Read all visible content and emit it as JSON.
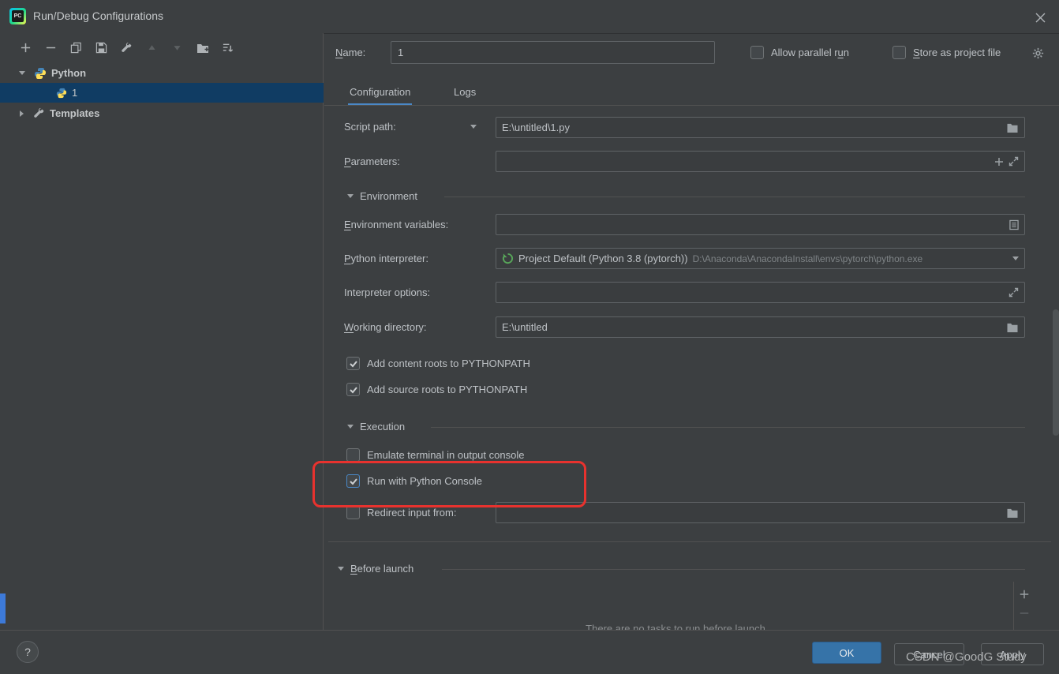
{
  "colors": {
    "dialog_background": "#3c3f41",
    "selection_blue": "#103c63",
    "tab_accent": "#4a88c7",
    "ok_button_blue": "#3673a8",
    "annotation_red": "#e8322e"
  },
  "title_bar": {
    "title": "Run/Debug Configurations"
  },
  "toolbar": {
    "icons": [
      "add",
      "remove",
      "copy",
      "save-configuration",
      "edit-templates",
      "move-up",
      "move-down",
      "create-new-folder",
      "sort-configurations"
    ]
  },
  "tree": {
    "python_group_label": "Python",
    "run_config_label": "1",
    "templates_label": "Templates"
  },
  "header": {
    "name_label": {
      "pre": "",
      "mn": "N",
      "post": "ame:"
    },
    "name_value": "1",
    "allow_parallel_run_label": {
      "pre": "Allow parallel r",
      "mn": "u",
      "post": "n"
    },
    "store_as_project_file_label": {
      "pre": "",
      "mn": "S",
      "post": "tore as project file"
    }
  },
  "tabs": {
    "configuration": "Configuration",
    "logs": "Logs"
  },
  "form": {
    "script_path_label": "Script path:",
    "script_path_value": "E:\\untitled\\1.py",
    "parameters_label": {
      "pre": "",
      "mn": "P",
      "post": "arameters:"
    },
    "environment_section_label": "Environment",
    "environment_variables_label": {
      "pre": "",
      "mn": "E",
      "post": "nvironment variables:"
    },
    "python_interpreter_label": {
      "pre": "",
      "mn": "P",
      "post": "ython interpreter:"
    },
    "python_interpreter_value": "Project Default (Python 3.8 (pytorch))",
    "python_interpreter_path": "D:\\Anaconda\\AnacondaInstall\\envs\\pytorch\\python.exe",
    "interpreter_options_label": "Interpreter options:",
    "working_directory_label": {
      "pre": "",
      "mn": "W",
      "post": "orking directory:"
    },
    "working_directory_value": "E:\\untitled",
    "add_content_roots_label": "Add content roots to PYTHONPATH",
    "add_source_roots_label": "Add source roots to PYTHONPATH",
    "execution_section_label": "Execution",
    "emulate_terminal_label": "Emulate terminal in output console",
    "run_with_python_console_label": "Run with Python Console",
    "redirect_input_label": "Redirect input from:"
  },
  "checkboxes": {
    "allow_parallel": false,
    "store_as_project": false,
    "add_content_roots": true,
    "add_source_roots": true,
    "emulate_terminal": false,
    "run_with_python_console": true,
    "redirect_input": false
  },
  "before_launch": {
    "section_label": {
      "pre": "",
      "mn": "B",
      "post": "efore launch"
    },
    "empty_text": "There are no tasks to run before launch"
  },
  "footer": {
    "help_glyph": "?",
    "ok_label": "OK",
    "cancel_label": "Cancel",
    "apply_label": "Apply"
  },
  "watermark": "CSDN @GoodG Study"
}
